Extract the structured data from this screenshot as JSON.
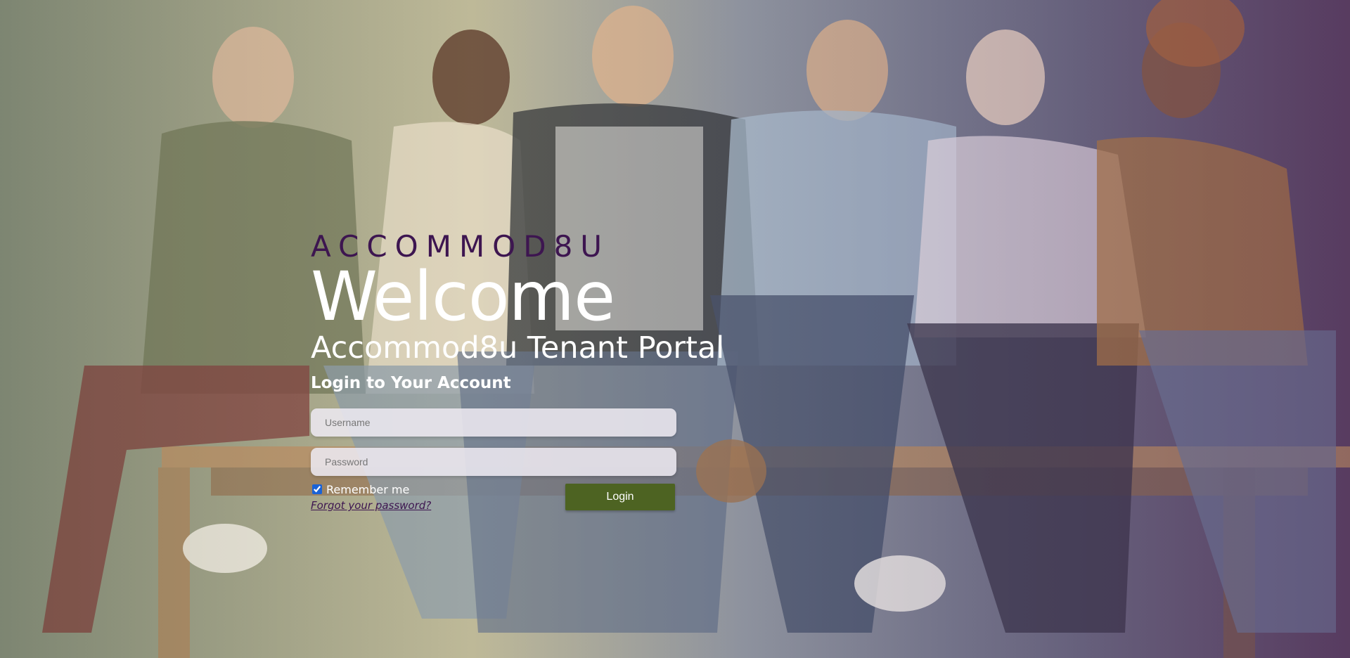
{
  "brand": {
    "logo_text": "ACCOMMOD8U"
  },
  "hero": {
    "welcome": "Welcome",
    "portal_title": "Accommod8u Tenant Portal"
  },
  "login_form": {
    "heading": "Login to Your Account",
    "username": {
      "value": "",
      "placeholder": "Username"
    },
    "password": {
      "value": "",
      "placeholder": "Password"
    },
    "remember_me": {
      "label": "Remember me",
      "checked": true
    },
    "forgot_password_label": "Forgot your password?",
    "login_button_label": "Login"
  },
  "colors": {
    "brand_purple": "#3d1550",
    "login_button": "#4d6322",
    "text_white": "#ffffff"
  }
}
